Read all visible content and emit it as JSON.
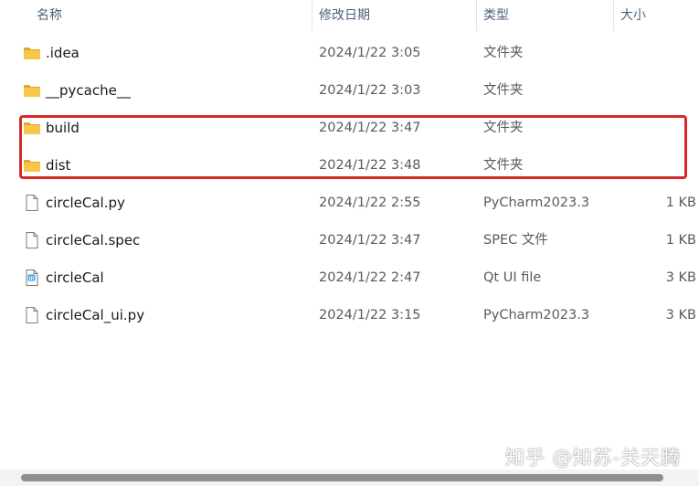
{
  "columns": {
    "name": "名称",
    "modified": "修改日期",
    "type": "类型",
    "size": "大小"
  },
  "files": [
    {
      "name": ".idea",
      "modified": "2024/1/22 3:05",
      "type": "文件夹",
      "size": "",
      "icon": "folder-icon"
    },
    {
      "name": "__pycache__",
      "modified": "2024/1/22 3:03",
      "type": "文件夹",
      "size": "",
      "icon": "folder-icon"
    },
    {
      "name": "build",
      "modified": "2024/1/22 3:47",
      "type": "文件夹",
      "size": "",
      "icon": "folder-icon"
    },
    {
      "name": "dist",
      "modified": "2024/1/22 3:48",
      "type": "文件夹",
      "size": "",
      "icon": "folder-icon"
    },
    {
      "name": "circleCal.py",
      "modified": "2024/1/22 2:55",
      "type": "PyCharm2023.3",
      "size": "1 KB",
      "icon": "file-icon"
    },
    {
      "name": "circleCal.spec",
      "modified": "2024/1/22 3:47",
      "type": "SPEC 文件",
      "size": "1 KB",
      "icon": "file-icon"
    },
    {
      "name": "circleCal",
      "modified": "2024/1/22 2:47",
      "type": "Qt UI file",
      "size": "3 KB",
      "icon": "qt-ui-file-icon"
    },
    {
      "name": "circleCal_ui.py",
      "modified": "2024/1/22 3:15",
      "type": "PyCharm2023.3",
      "size": "3 KB",
      "icon": "file-icon"
    }
  ],
  "watermark": "知乎 @知苏-关天腾",
  "colors": {
    "highlight_border": "#d72a26",
    "folder": "#f8c64a",
    "header_text": "#4c607a"
  }
}
